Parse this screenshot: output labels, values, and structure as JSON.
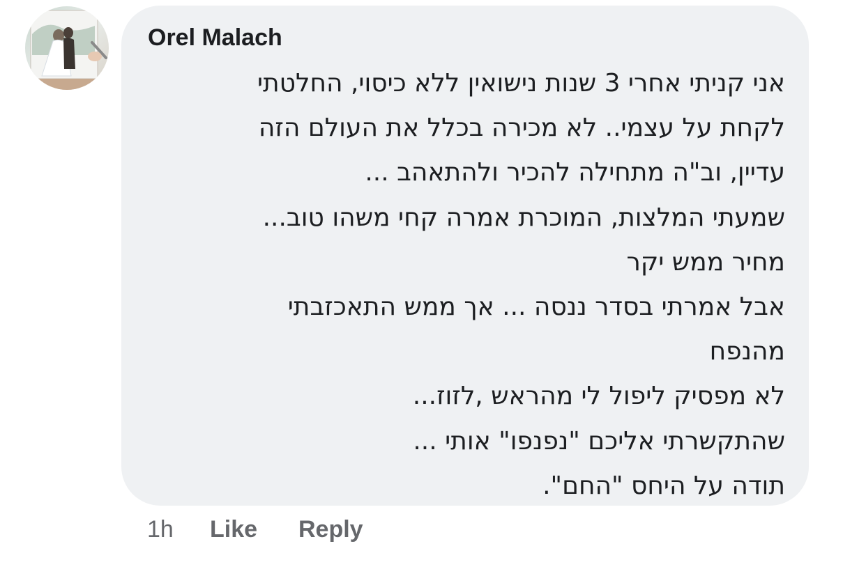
{
  "comment": {
    "author": "Orel Malach",
    "avatar_icon": "profile-photo-wedding",
    "lines": [
      "אני קניתי אחרי 3 שנות נישואין ללא כיסוי, החלטתי",
      "לקחת על עצמי.. לא מכירה בכלל את העולם הזה",
      "עדיין, וב\"ה מתחילה להכיר ולהתאהב ...",
      "שמעתי המלצות, המוכרת אמרה קחי משהו טוב...",
      "מחיר ממש יקר",
      "אבל אמרתי בסדר ננסה ... אך  ממש התאכזבתי",
      "מהנפח",
      "לא מפסיק ליפול לי מהראש ,לזוז...",
      "שהתקשרתי אליכם \"נפנפו\" אותי ...",
      "תודה על היחס \"החם\"."
    ]
  },
  "actions": {
    "time": "1h",
    "like_label": "Like",
    "reply_label": "Reply"
  },
  "colors": {
    "bubble_background": "#eff1f3",
    "text": "#1c1e21",
    "secondary_text": "#65676b"
  }
}
